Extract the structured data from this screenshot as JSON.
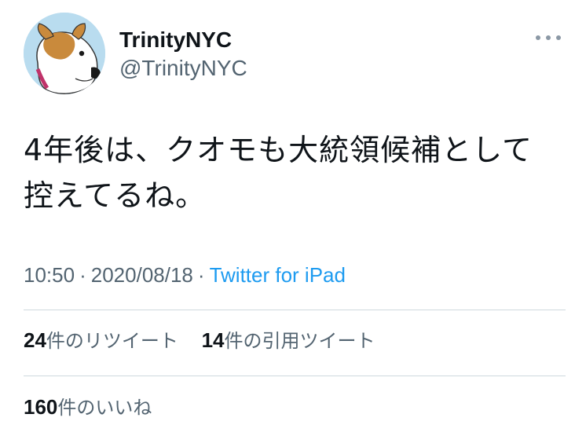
{
  "user": {
    "display_name": "TrinityNYC",
    "handle": "@TrinityNYC"
  },
  "tweet": {
    "text_line1": "4年後は、クオモも大統領候補として",
    "text_line2": "控えてるね。",
    "time": "10:50",
    "separator": "·",
    "date": "2020/08/18",
    "source": "Twitter for iPad"
  },
  "stats": {
    "retweets": {
      "count": "24",
      "label": "件のリツイート"
    },
    "quotes": {
      "count": "14",
      "label": "件の引用ツイート"
    },
    "likes": {
      "count": "160",
      "label": "件のいいね"
    }
  },
  "icons": {
    "avatar": "dog-avatar",
    "more": "more-horizontal-icon"
  },
  "colors": {
    "text_primary": "#0f1419",
    "text_secondary": "#536471",
    "link": "#1d9bf0",
    "divider": "#cfd9de",
    "avatar_bg": "#b9dcef"
  }
}
